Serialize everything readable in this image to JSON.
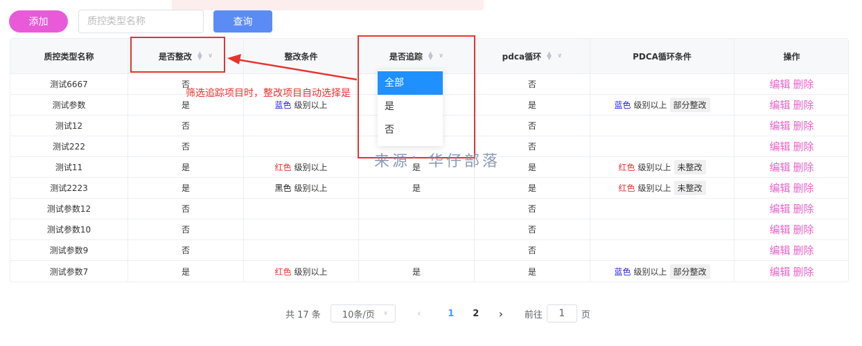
{
  "toolbar": {
    "add_label": "添加",
    "search_placeholder": "质控类型名称",
    "query_label": "查询"
  },
  "columns": [
    "质控类型名称",
    "是否整改",
    "整改条件",
    "是否追踪",
    "pdca循环",
    "PDCA循环条件",
    "操作"
  ],
  "rows": [
    {
      "name": "测试6667",
      "rectify": "否",
      "cond_color": "",
      "cond_text": "",
      "track": "",
      "pdca": "否",
      "p_color": "",
      "p_text": "",
      "p_tag": ""
    },
    {
      "name": "测试参数",
      "rectify": "是",
      "cond_color": "蓝色",
      "cond_text": "级别以上",
      "track": "",
      "pdca": "是",
      "p_color": "蓝色",
      "p_text": "级别以上",
      "p_tag": "部分整改"
    },
    {
      "name": "测试12",
      "rectify": "否",
      "cond_color": "",
      "cond_text": "",
      "track": "",
      "pdca": "否",
      "p_color": "",
      "p_text": "",
      "p_tag": ""
    },
    {
      "name": "测试222",
      "rectify": "否",
      "cond_color": "",
      "cond_text": "",
      "track": "",
      "pdca": "否",
      "p_color": "",
      "p_text": "",
      "p_tag": ""
    },
    {
      "name": "测试11",
      "rectify": "是",
      "cond_color": "红色",
      "cond_text": "级别以上",
      "track": "是",
      "pdca": "是",
      "p_color": "红色",
      "p_text": "级别以上",
      "p_tag": "未整改"
    },
    {
      "name": "测试2223",
      "rectify": "是",
      "cond_color": "黑色",
      "cond_text": "级别以上",
      "track": "是",
      "pdca": "是",
      "p_color": "红色",
      "p_text": "级别以上",
      "p_tag": "未整改"
    },
    {
      "name": "测试参数12",
      "rectify": "否",
      "cond_color": "",
      "cond_text": "",
      "track": "",
      "pdca": "否",
      "p_color": "",
      "p_text": "",
      "p_tag": ""
    },
    {
      "name": "测试参数10",
      "rectify": "否",
      "cond_color": "",
      "cond_text": "",
      "track": "",
      "pdca": "否",
      "p_color": "",
      "p_text": "",
      "p_tag": ""
    },
    {
      "name": "测试参数9",
      "rectify": "否",
      "cond_color": "",
      "cond_text": "",
      "track": "",
      "pdca": "否",
      "p_color": "",
      "p_text": "",
      "p_tag": ""
    },
    {
      "name": "测试参数7",
      "rectify": "是",
      "cond_color": "红色",
      "cond_text": "级别以上",
      "track": "是",
      "pdca": "是",
      "p_color": "蓝色",
      "p_text": "级别以上",
      "p_tag": "部分整改"
    }
  ],
  "actions": {
    "edit": "编辑",
    "delete": "删除"
  },
  "color_map": {
    "蓝色": "#2222dd",
    "红色": "#e8322e",
    "黑色": "#222222"
  },
  "dropdown": {
    "options": [
      "全部",
      "是",
      "否"
    ],
    "selected": "全部"
  },
  "annotation": "筛选追踪项目时，整改项目自动选择是",
  "watermark": "来源：华仔部落",
  "pagination": {
    "total": "共 17 条",
    "page_size": "10条/页",
    "pages": [
      "1",
      "2"
    ],
    "current": "1",
    "goto_label": "前往",
    "goto_value": "1",
    "page_suffix": "页"
  }
}
